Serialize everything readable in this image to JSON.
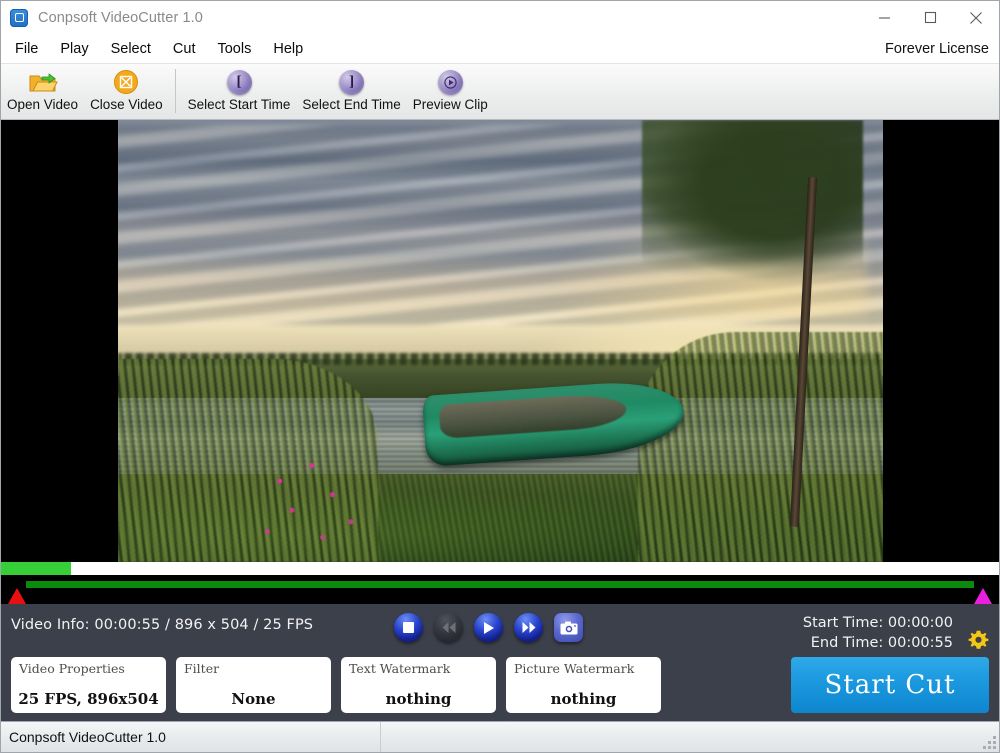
{
  "window": {
    "title": "Conpsoft VideoCutter 1.0",
    "app_icon": "video-cutter-icon",
    "minimize_label": "Minimize",
    "maximize_label": "Maximize",
    "close_label": "Close"
  },
  "menu": {
    "items": [
      {
        "label": "File",
        "name": "menu-file"
      },
      {
        "label": "Play",
        "name": "menu-play"
      },
      {
        "label": "Select",
        "name": "menu-select"
      },
      {
        "label": "Cut",
        "name": "menu-cut"
      },
      {
        "label": "Tools",
        "name": "menu-tools"
      },
      {
        "label": "Help",
        "name": "menu-help"
      }
    ],
    "license_label": "Forever License"
  },
  "toolbar": {
    "buttons": [
      {
        "label": "Open Video",
        "icon": "open-folder-icon"
      },
      {
        "label": "Close Video",
        "icon": "close-circle-icon"
      },
      {
        "label": "Select Start Time",
        "icon": "start-bracket-icon"
      },
      {
        "label": "Select End Time",
        "icon": "end-bracket-icon"
      },
      {
        "label": "Preview Clip",
        "icon": "preview-play-icon"
      }
    ]
  },
  "preview": {
    "scene_description": "Green rowboat on a lake shore at dusk"
  },
  "timeline": {
    "progress_percent": 7,
    "range_start_marker": "start-marker",
    "range_end_marker": "end-marker"
  },
  "controls": {
    "video_info": "Video Info: 00:00:55 / 896 x 504 / 25 FPS",
    "transport": [
      {
        "name": "stop-button",
        "icon": "stop-icon",
        "enabled": true
      },
      {
        "name": "rewind-button",
        "icon": "rewind-icon",
        "enabled": false
      },
      {
        "name": "play-button",
        "icon": "play-icon",
        "enabled": true
      },
      {
        "name": "forward-button",
        "icon": "fast-forward-icon",
        "enabled": true
      },
      {
        "name": "snapshot-button",
        "icon": "camera-icon",
        "enabled": true
      }
    ],
    "start_time_label": "Start Time: 00:00:00",
    "end_time_label": "End Time: 00:00:55",
    "settings_icon": "gear-icon"
  },
  "info_boxes": [
    {
      "caption": "Video Properties",
      "value": "25 FPS, 896x504"
    },
    {
      "caption": "Filter",
      "value": "None"
    },
    {
      "caption": "Text Watermark",
      "value": "nothing"
    },
    {
      "caption": "Picture Watermark",
      "value": "nothing"
    }
  ],
  "start_cut": {
    "label": "Start Cut"
  },
  "statusbar": {
    "text": "Conpsoft VideoCutter 1.0"
  },
  "colors": {
    "accent_blue": "#1c9ae0",
    "panel_dark": "#3c404b",
    "progress_green": "#36cf37",
    "range_green": "#0b8a0b",
    "marker_red": "#e81010",
    "marker_magenta": "#ea1fe0",
    "gear_yellow": "#f5c518"
  }
}
